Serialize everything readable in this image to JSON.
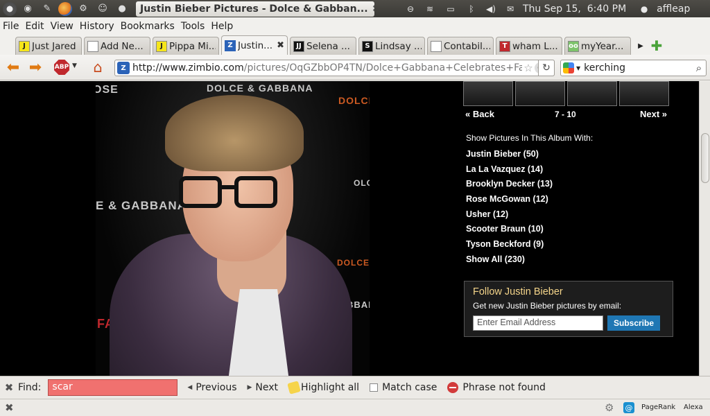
{
  "panel": {
    "window_title": "Justin Bieber Pictures - Dolce & Gabban...",
    "clock": "Thu Sep 15,  6:40 PM",
    "user": "affleap"
  },
  "menubar": [
    "File",
    "Edit",
    "View",
    "History",
    "Bookmarks",
    "Tools",
    "Help"
  ],
  "tabs": [
    {
      "title": "Just Jared",
      "icon": "J"
    },
    {
      "title": "Add Ne...",
      "icon": ""
    },
    {
      "title": "Pippa Mi...",
      "icon": "J"
    },
    {
      "title": "Justin...",
      "icon": "Z",
      "active": true
    },
    {
      "title": "Selena ...",
      "icon": "JJ"
    },
    {
      "title": "Lindsay ...",
      "icon": "S"
    },
    {
      "title": "Contabil...",
      "icon": ""
    },
    {
      "title": "wham L...",
      "icon": "T"
    },
    {
      "title": "myYear...",
      "icon": "oo"
    }
  ],
  "navbar": {
    "url_host": "http://www.zimbio.com",
    "url_path": "/pictures/OqGZbbOP4TN/Dolce+Gabbana+Celebrates+Fa",
    "abp_label": "ABP",
    "search_value": "kerching"
  },
  "photo": {
    "brand_texts": [
      "OSE",
      "DOLCE & GABBANA",
      "E & GABBANA",
      "DOLCE",
      "OLC",
      "DOLCE&",
      "BBANA",
      "FA"
    ]
  },
  "sidebar": {
    "back": "« Back",
    "range": "7 - 10",
    "next": "Next »",
    "album_heading": "Show Pictures In This Album With:",
    "album_items": [
      "Justin Bieber (50)",
      "La La Vazquez (14)",
      "Brooklyn Decker (13)",
      "Rose McGowan (12)",
      "Usher (12)",
      "Scooter Braun (10)",
      "Tyson Beckford (9)",
      "Show All (230)"
    ],
    "follow": {
      "title": "Follow Justin Bieber",
      "desc": "Get new Justin Bieber pictures by email:",
      "email_placeholder": "Enter Email Address",
      "submit": "Subscribe"
    }
  },
  "findbar": {
    "label": "Find:",
    "value": "scar",
    "previous": "Previous",
    "next": "Next",
    "highlight": "Highlight all",
    "match_case": "Match case",
    "status": "Phrase not found"
  },
  "statusbar": {
    "pagerank": "PageRank",
    "alexa": "Alexa"
  },
  "colors": {
    "find_not_found": "#f0716f",
    "follow_title": "#f5d58a",
    "subscribe": "#1f77b4",
    "nav_arrow": "#e07a13"
  }
}
